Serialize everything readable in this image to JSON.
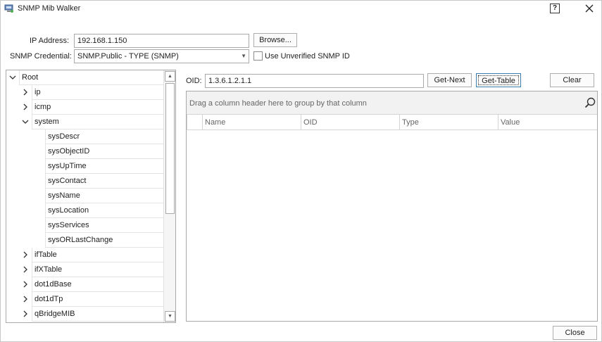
{
  "window": {
    "title": "SNMP Mib Walker"
  },
  "form": {
    "ip_label": "IP Address:",
    "ip_value": "192.168.1.150",
    "browse_label": "Browse...",
    "credential_label": "SNMP Credential:",
    "credential_value": "SNMP.Public - TYPE (SNMP)",
    "unverified_label": "Use Unverified SNMP ID",
    "unverified_checked": false
  },
  "tree": {
    "root": "Root",
    "items": [
      {
        "label": "ip",
        "level": 1,
        "expanded": false
      },
      {
        "label": "icmp",
        "level": 1,
        "expanded": false
      },
      {
        "label": "system",
        "level": 1,
        "expanded": true
      },
      {
        "label": "sysDescr",
        "level": 2
      },
      {
        "label": "sysObjectID",
        "level": 2
      },
      {
        "label": "sysUpTime",
        "level": 2
      },
      {
        "label": "sysContact",
        "level": 2
      },
      {
        "label": "sysName",
        "level": 2
      },
      {
        "label": "sysLocation",
        "level": 2
      },
      {
        "label": "sysServices",
        "level": 2
      },
      {
        "label": "sysORLastChange",
        "level": 2
      },
      {
        "label": "ifTable",
        "level": 1,
        "expanded": false
      },
      {
        "label": "ifXTable",
        "level": 1,
        "expanded": false
      },
      {
        "label": "dot1dBase",
        "level": 1,
        "expanded": false
      },
      {
        "label": "dot1dTp",
        "level": 1,
        "expanded": false
      },
      {
        "label": "qBridgeMIB",
        "level": 1,
        "expanded": false
      }
    ]
  },
  "oid": {
    "label": "OID:",
    "value": "1.3.6.1.2.1.1",
    "get_next_label": "Get-Next",
    "get_table_label": "Get-Table",
    "clear_label": "Clear"
  },
  "grid": {
    "group_hint": "Drag a column header here to group by that column",
    "columns": [
      "Name",
      "OID",
      "Type",
      "Value"
    ]
  },
  "footer": {
    "close_label": "Close"
  }
}
